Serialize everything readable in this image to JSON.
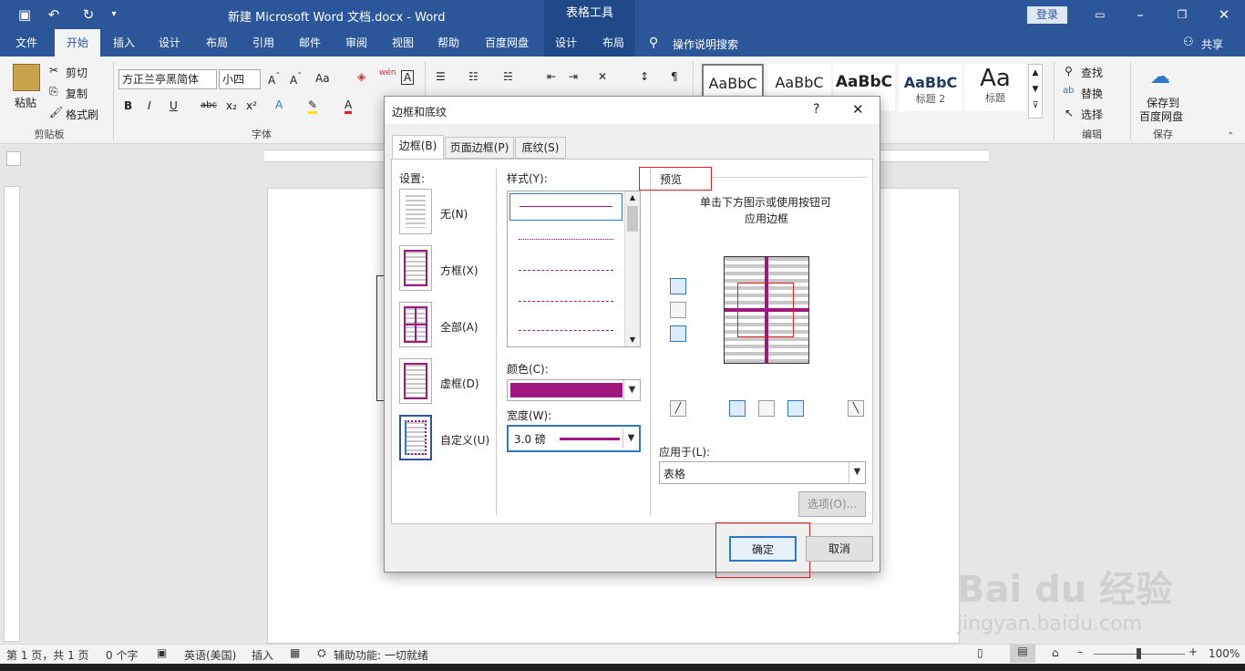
{
  "window": {
    "title": "新建 Microsoft Word 文档.docx  -  Word",
    "context_title": "表格工具",
    "login": "登录"
  },
  "tabs": [
    "文件",
    "开始",
    "插入",
    "设计",
    "布局",
    "引用",
    "邮件",
    "审阅",
    "视图",
    "帮助",
    "百度网盘",
    "设计",
    "布局"
  ],
  "tell_me": "操作说明搜索",
  "share": "共享",
  "ribbon": {
    "clipboard": {
      "paste": "粘贴",
      "cut": "剪切",
      "copy": "复制",
      "format_painter": "格式刷",
      "group": "剪贴板"
    },
    "font": {
      "name": "方正兰亭黑简体",
      "size": "小四",
      "group": "字体"
    },
    "styles": [
      {
        "preview": "AaBbC",
        "label": ""
      },
      {
        "preview": "AaBbC",
        "label": ""
      },
      {
        "preview": "AaBbC",
        "label": ""
      },
      {
        "preview": "AaBbC",
        "label": "标题 2"
      },
      {
        "preview": "Aa",
        "label": "标题"
      }
    ],
    "editing": {
      "find": "查找",
      "replace": "替换",
      "select": "选择",
      "group": "编辑"
    },
    "save": {
      "label1": "保存到",
      "label2": "百度网盘",
      "group": "保存"
    }
  },
  "status": {
    "page": "第 1 页，共 1 页",
    "words": "0 个字",
    "lang": "英语(美国)",
    "mode": "插入",
    "accessibility": "辅助功能: 一切就绪",
    "zoom": "100%"
  },
  "dialog": {
    "title": "边框和底纹",
    "help": "?",
    "close": "✕",
    "tabs": [
      "边框(B)",
      "页面边框(P)",
      "底纹(S)"
    ],
    "settings_label": "设置:",
    "settings": [
      "无(N)",
      "方框(X)",
      "全部(A)",
      "虚框(D)",
      "自定义(U)"
    ],
    "style_label": "样式(Y):",
    "color_label": "颜色(C):",
    "width_label": "宽度(W):",
    "width_value": "3.0 磅",
    "preview_label": "预览",
    "preview_hint1": "单击下方图示或使用按钮可",
    "preview_hint2": "应用边框",
    "apply_label": "应用于(L):",
    "apply_value": "表格",
    "options": "选项(O)...",
    "ok": "确定",
    "cancel": "取消"
  },
  "colors": {
    "brand": "#2b579a",
    "border": "#a0187f"
  },
  "watermark": {
    "text": "Bai du 经验",
    "url": "jingyan.baidu.com"
  }
}
